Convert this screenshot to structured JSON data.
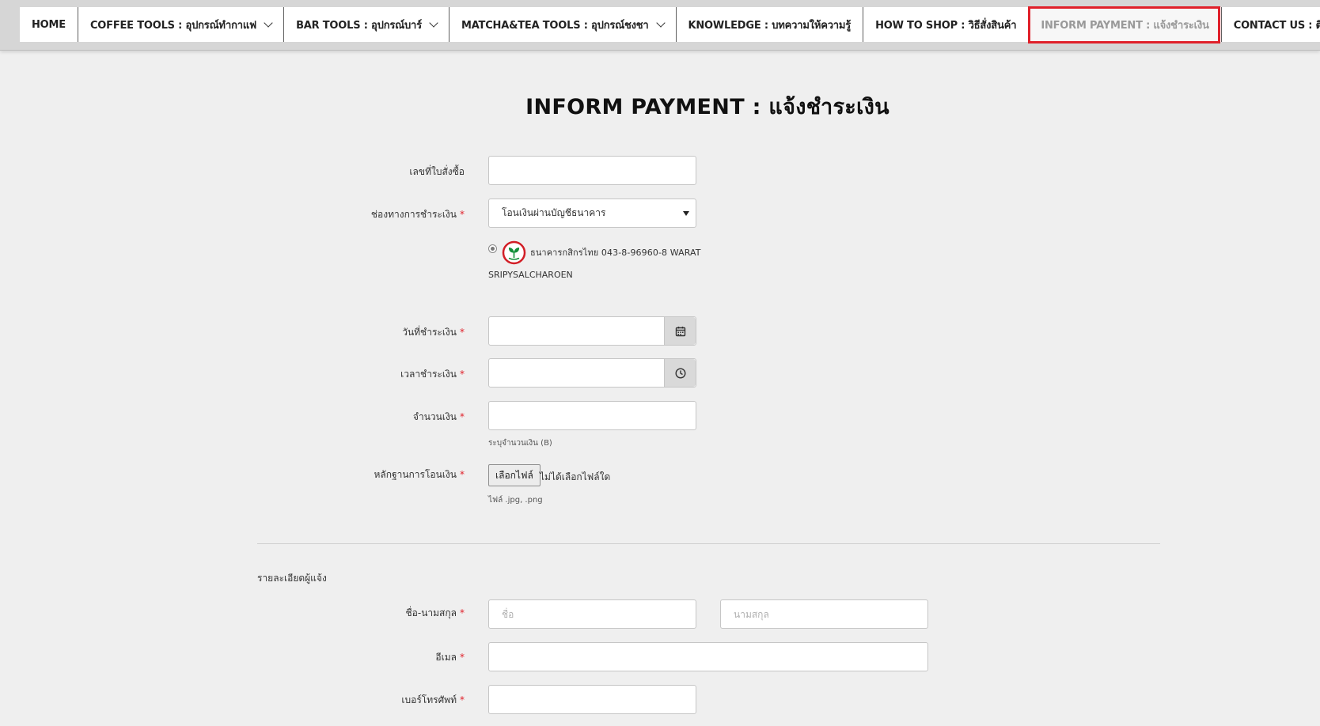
{
  "nav": {
    "items": [
      {
        "label": "HOME",
        "dropdown": false,
        "active": false
      },
      {
        "label": "COFFEE TOOLS : อุปกรณ์ทำกาแฟ",
        "dropdown": true,
        "active": false
      },
      {
        "label": "BAR TOOLS : อุปกรณ์บาร์",
        "dropdown": true,
        "active": false
      },
      {
        "label": "MATCHA&TEA TOOLS : อุปกรณ์ชงชา",
        "dropdown": true,
        "active": false
      },
      {
        "label": "KNOWLEDGE : บทความให้ความรู้",
        "dropdown": false,
        "active": false
      },
      {
        "label": "HOW TO SHOP : วิธีสั่งสินค้า",
        "dropdown": false,
        "active": false
      },
      {
        "label": "INFORM PAYMENT : แจ้งชำระเงิน",
        "dropdown": false,
        "active": true
      },
      {
        "label": "CONTACT US : ติดต่อเรา",
        "dropdown": false,
        "active": false
      }
    ],
    "active_outline_color": "#e0202a"
  },
  "page": {
    "title": "INFORM PAYMENT : แจ้งชำระเงิน"
  },
  "form": {
    "order_no": {
      "label": "เลขที่ใบสั่งซื้อ",
      "value": "",
      "placeholder": ""
    },
    "channel": {
      "label": "ช่องทางการชำระเงิน",
      "selected": "โอนเงินผ่านบัญชีธนาคาร"
    },
    "bank": {
      "line1": "ธนาคารกสิกรไทย  043-8-96960-8  WARAT",
      "line2": "SRIPYSALCHAROEN",
      "logo_color": "#138f3a"
    },
    "pay_date": {
      "label": "วันที่ชำระเงิน",
      "value": "",
      "icon": "calendar-icon"
    },
    "pay_time": {
      "label": "เวลาชำระเงิน",
      "value": "",
      "icon": "clock-icon"
    },
    "amount": {
      "label": "จำนวนเงิน",
      "value": "",
      "hint": "ระบุจำนวนเงิน (B)"
    },
    "proof": {
      "label": "หลักฐานการโอนเงิน",
      "button": "เลือกไฟล์",
      "status": "ไม่ได้เลือกไฟล์ใด",
      "hint": "ไฟล์ .jpg, .png"
    },
    "section_title": "รายละเอียดผู้แจ้ง",
    "name": {
      "label": "ชื่อ-นามสกุล",
      "first_placeholder": "ชื่อ",
      "last_placeholder": "นามสกุล"
    },
    "email": {
      "label": "อีเมล",
      "value": ""
    },
    "phone": {
      "label": "เบอร์โทรศัพท์",
      "value": ""
    },
    "required_color": "#e0202a"
  }
}
